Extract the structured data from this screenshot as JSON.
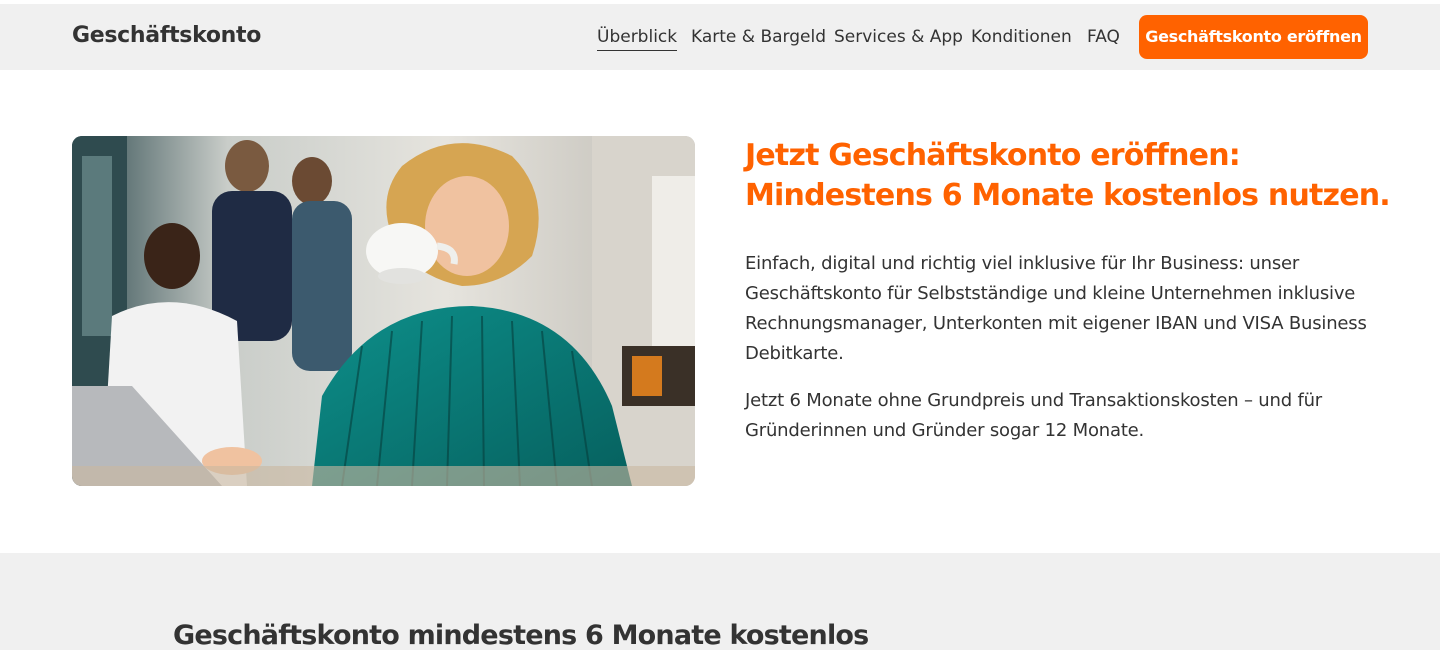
{
  "header": {
    "brand": "Geschäftskonto",
    "nav": [
      "Überblick",
      "Karte & Bargeld",
      "Services & App",
      "Konditionen",
      "FAQ"
    ],
    "active_nav": "Überblick",
    "cta_label": "Geschäftskonto eröffnen"
  },
  "hero": {
    "image_alt": "Frau trinkt Kaffee im Café, im Hintergrund Personen am Laptop",
    "headline_line1": "Jetzt Geschäftskonto eröffnen:",
    "headline_line2": "Mindestens 6 Monate kostenlos nutzen.",
    "paragraph1": "Einfach, digital und richtig viel inklusive für Ihr Business: unser Geschäftskonto für Selbstständige und kleine Unternehmen inklusive Rechnungsmanager, Unterkonten mit eigener IBAN und VISA Business Debitkarte.",
    "paragraph2": "Jetzt 6 Monate ohne Grundpreis und Transaktionskosten – und für Gründerinnen und Gründer sogar 12 Monate."
  },
  "section2": {
    "title": "Geschäftskonto mindestens 6 Monate kostenlos"
  },
  "colors": {
    "accent": "#ff6200",
    "header_bg": "#f0f0f0",
    "text": "#333333"
  }
}
